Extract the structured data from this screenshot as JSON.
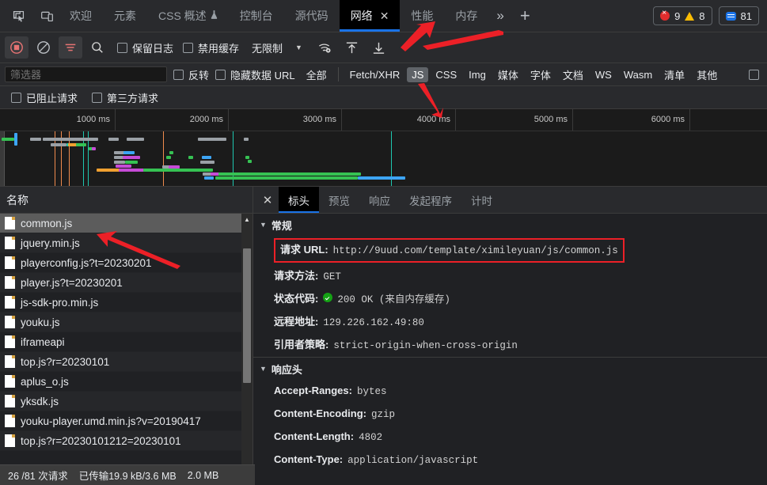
{
  "window": {
    "tabs": [
      {
        "label": "欢迎",
        "active": false
      },
      {
        "label": "元素",
        "active": false
      },
      {
        "label": "CSS 概述",
        "active": false,
        "badge": "flask"
      },
      {
        "label": "控制台",
        "active": false
      },
      {
        "label": "源代码",
        "active": false
      },
      {
        "label": "网络",
        "active": true,
        "closable": true
      },
      {
        "label": "性能",
        "active": false
      },
      {
        "label": "内存",
        "active": false
      }
    ],
    "more_label": "»",
    "add_label": "+",
    "counters": {
      "errors": "9",
      "warnings": "8",
      "info": "81"
    },
    "icons": {
      "inspect": "inspect-element-icon",
      "device": "device-toolbar-icon"
    }
  },
  "network_toolbar": {
    "record_title": "record-stop-button",
    "clear_title": "clear-button",
    "filter_title": "filter-button",
    "search_title": "search-button",
    "preserve_log_label": "保留日志",
    "disable_cache_label": "禁用缓存",
    "throttle_value": "无限制",
    "throttle_caret": "▼",
    "wifi_title": "network-conditions-icon",
    "import_title": "import-har-icon",
    "export_title": "export-har-icon"
  },
  "filter_bar": {
    "placeholder": "筛选器",
    "value": "",
    "invert_label": "反转",
    "hide_data_urls_label": "隐藏数据 URL",
    "types": [
      {
        "label": "全部",
        "selected": false
      },
      {
        "label": "Fetch/XHR",
        "selected": false
      },
      {
        "label": "JS",
        "selected": true
      },
      {
        "label": "CSS",
        "selected": false
      },
      {
        "label": "Img",
        "selected": false
      },
      {
        "label": "媒体",
        "selected": false
      },
      {
        "label": "字体",
        "selected": false
      },
      {
        "label": "文档",
        "selected": false
      },
      {
        "label": "WS",
        "selected": false
      },
      {
        "label": "Wasm",
        "selected": false
      },
      {
        "label": "清单",
        "selected": false
      },
      {
        "label": "其他",
        "selected": false
      }
    ],
    "trailing_checkbox": "has-blocked-cookies"
  },
  "extra_filters": {
    "blocked_requests_label": "已阻止请求",
    "third_party_label": "第三方请求"
  },
  "overview": {
    "ticks": [
      "1000 ms",
      "2000 ms",
      "3000 ms",
      "4000 ms",
      "5000 ms",
      "6000 ms"
    ]
  },
  "request_list": {
    "header": "名称",
    "items": [
      {
        "name": "common.js",
        "selected": true
      },
      {
        "name": "jquery.min.js",
        "selected": false
      },
      {
        "name": "playerconfig.js?t=20230201",
        "selected": false
      },
      {
        "name": "player.js?t=20230201",
        "selected": false
      },
      {
        "name": "js-sdk-pro.min.js",
        "selected": false
      },
      {
        "name": "youku.js",
        "selected": false
      },
      {
        "name": "iframeapi",
        "selected": false
      },
      {
        "name": "top.js?r=20230101",
        "selected": false
      },
      {
        "name": "aplus_o.js",
        "selected": false
      },
      {
        "name": "yksdk.js",
        "selected": false
      },
      {
        "name": "youku-player.umd.min.js?v=20190417",
        "selected": false
      },
      {
        "name": "top.js?r=20230101212=20230101",
        "selected": false
      }
    ]
  },
  "details": {
    "close_label": "✕",
    "tabs": [
      {
        "label": "标头",
        "active": true
      },
      {
        "label": "预览",
        "active": false
      },
      {
        "label": "响应",
        "active": false
      },
      {
        "label": "发起程序",
        "active": false
      },
      {
        "label": "计时",
        "active": false
      }
    ],
    "general": {
      "title": "常规",
      "caret": "▼",
      "rows": [
        {
          "key": "请求 URL:",
          "value": "http://9uud.com/template/ximileyuan/js/common.js",
          "highlight": true
        },
        {
          "key": "请求方法:",
          "value": "GET"
        },
        {
          "key": "状态代码:",
          "value": "200 OK (来自内存缓存)",
          "status_ok": true
        },
        {
          "key": "远程地址:",
          "value": "129.226.162.49:80"
        },
        {
          "key": "引用者策略:",
          "value": "strict-origin-when-cross-origin"
        }
      ]
    },
    "response_headers": {
      "title": "响应头",
      "caret": "▼",
      "rows": [
        {
          "key": "Accept-Ranges:",
          "value": "bytes"
        },
        {
          "key": "Content-Encoding:",
          "value": "gzip"
        },
        {
          "key": "Content-Length:",
          "value": "4802"
        },
        {
          "key": "Content-Type:",
          "value": "application/javascript"
        }
      ]
    }
  },
  "status_bar": {
    "requests": "26 /81 次请求",
    "transferred": "已传输19.9 kB/3.6 MB",
    "resources": "2.0 MB"
  },
  "colors": {
    "accent": "#1a73e8",
    "panel": "#292a2d",
    "background": "#202124",
    "selection": "#5c5c5c",
    "error": "#e02d2d",
    "warning": "#fbbc04",
    "annotation": "#ec2027",
    "ok": "#15a215"
  }
}
